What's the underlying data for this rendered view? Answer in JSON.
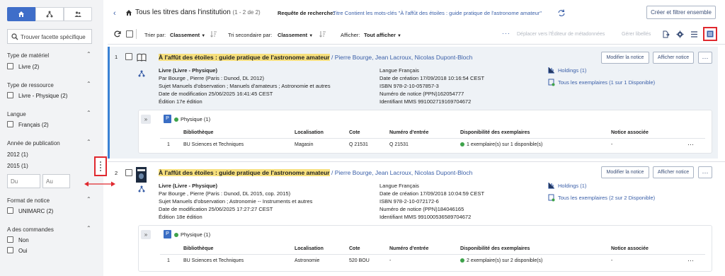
{
  "sidebar": {
    "search_placeholder": "Trouver facette spécifique",
    "facets": {
      "material": {
        "title": "Type de matériel",
        "options": [
          {
            "label": "Livre (2)"
          }
        ]
      },
      "resource": {
        "title": "Type de ressource",
        "options": [
          {
            "label": "Livre - Physique (2)"
          }
        ]
      },
      "language": {
        "title": "Langue",
        "options": [
          {
            "label": "Français (2)"
          }
        ]
      },
      "year": {
        "title": "Année de publication",
        "values": [
          "2012 (1)",
          "2015 (1)"
        ],
        "from_placeholder": "Du",
        "to_placeholder": "Au"
      },
      "format": {
        "title": "Format de notice",
        "options": [
          {
            "label": "UNIMARC (2)"
          }
        ]
      },
      "orders": {
        "title": "A des commandes",
        "options": [
          {
            "label": "Non"
          },
          {
            "label": "Oui"
          }
        ]
      }
    }
  },
  "header": {
    "title": "Tous les titres dans l'institution",
    "count": "(1 - 2 de 2)",
    "query_label": "Requête de recherche:",
    "query_value": "Titre Contient les mots-clés \"À l'affût des étoiles : guide pratique de l'astronome amateur\"",
    "create_filter_button": "Créer et filtrer ensemble"
  },
  "toolbar": {
    "sort_label": "Trier par:",
    "sort_value": "Classement",
    "secondary_sort_label": "Tri secondaire par:",
    "secondary_sort_value": "Classement",
    "display_label": "Afficher:",
    "display_value": "Tout afficher",
    "move_to_editor": "Déplacer vers l'Éditeur de métadonnées",
    "manage_labels": "Gérer libellés"
  },
  "records": [
    {
      "number": "1",
      "title_hl": "À l'affût des étoiles : guide pratique de l'astronome amateur",
      "authors": " / Pierre Bourge, Jean Lacroux, Nicolas Dupont-Bloch",
      "type": "Livre (Livre - Physique)",
      "by": "Par Bourge , Pierre (Paris : Dunod, DL 2012)",
      "subject": "Sujet Manuels d'observation ; Manuels d'amateurs ; Astronomie et autres",
      "modified": "Date de modification 25/06/2025 16:41:45 CEST",
      "edition": "Édition 17e édition",
      "language": "Langue Français",
      "created": "Date de création 17/09/2018 10:16:54 CEST",
      "isbn": "ISBN 978-2-10-057857-3",
      "notice_no": "Numéro de notice (PPN)162054777",
      "mms": "Identifiant MMS 991002719169704672",
      "holdings": "Holdings (1)",
      "items": "Tous les exemplaires (1 sur 1 Disponible)",
      "edit_button": "Modifier la notice",
      "show_button": "Afficher notice",
      "physical_badge": "P",
      "physical_label": "Physique (1)",
      "table_headers": [
        "Bibliothèque",
        "Localisation",
        "Cote",
        "Numéro d'entrée",
        "Disponibilité des exemplaires",
        "Notice associée"
      ],
      "rows": [
        {
          "n": "1",
          "library": "BU Sciences et Techniques",
          "location": "Magasin",
          "call": "Q 21531",
          "entry": "Q 21531",
          "availability": "1 exemplaire(s) sur 1 disponible(s)",
          "assoc": "-"
        }
      ]
    },
    {
      "number": "2",
      "title_hl": "À l'affût des étoiles : guide pratique de l'astronome amateur",
      "authors": " / Pierre Bourge, Jean Lacroux, Nicolas Dupont-Bloch",
      "type": "Livre (Livre - Physique)",
      "by": "Par Bourge , Pierre (Paris : Dunod, DL 2015, cop. 2015)",
      "subject": "Sujet Manuels d'observation ; Astronomie -- Instruments et autres",
      "modified": "Date de modification 25/06/2025 17:27:27 CEST",
      "edition": "Édition 18e édition",
      "language": "Langue Français",
      "created": "Date de création 17/09/2018 10:04:59 CEST",
      "isbn": "ISBN 978-2-10-072172-6",
      "notice_no": "Numéro de notice (PPN)184046165",
      "mms": "Identifiant MMS 991000536589704672",
      "holdings": "Holdings (1)",
      "items": "Tous les exemplaires (2 sur 2 Disponible)",
      "edit_button": "Modifier la notice",
      "show_button": "Afficher notice",
      "physical_badge": "P",
      "physical_label": "Physique (1)",
      "table_headers": [
        "Bibliothèque",
        "Localisation",
        "Cote",
        "Numéro d'entrée",
        "Disponibilité des exemplaires",
        "Notice associée"
      ],
      "rows": [
        {
          "n": "1",
          "library": "BU Sciences et Techniques",
          "location": "Astronomie",
          "call": "520 BOU",
          "entry": "-",
          "availability": "2 exemplaire(s) sur 2 disponible(s)",
          "assoc": "-"
        }
      ]
    }
  ]
}
